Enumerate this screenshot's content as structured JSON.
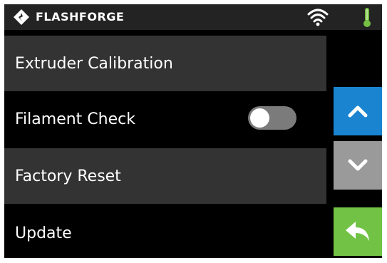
{
  "header": {
    "brand": "FLASHFORGE",
    "logo_icon": "flashforge-logo-icon",
    "wifi_icon": "wifi-icon",
    "temperature_icon": "thermometer-icon"
  },
  "menu": {
    "items": [
      {
        "label": "Extruder Calibration"
      },
      {
        "label": "Filament Check",
        "toggle": {
          "state": "off"
        }
      },
      {
        "label": "Factory Reset"
      },
      {
        "label": "Update"
      }
    ]
  },
  "nav": {
    "up_icon": "chevron-up-icon",
    "down_icon": "chevron-down-icon",
    "back_icon": "back-arrow-icon"
  },
  "colors": {
    "top_bar": "#232323",
    "menu_row_dark": "#333333",
    "menu_row_black": "#000000",
    "up_button": "#1a84d0",
    "down_button": "#9a9a9a",
    "back_button": "#72c345",
    "thermometer": "#76c043",
    "toggle_track": "#7b7b7b"
  }
}
